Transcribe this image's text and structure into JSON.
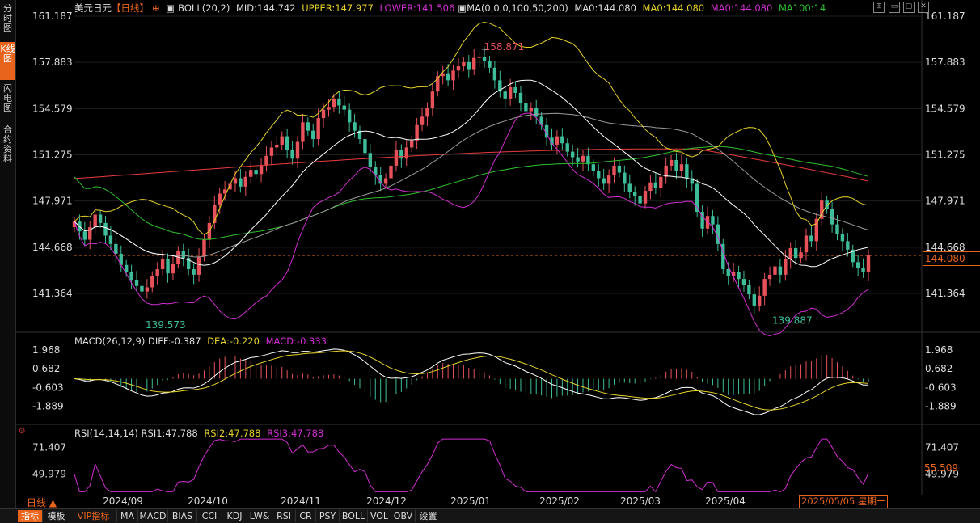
{
  "sidebar": {
    "tabs": [
      {
        "label": "分时图",
        "active": false
      },
      {
        "label": "K线图",
        "active": true
      },
      {
        "label": "闪电图",
        "active": false
      },
      {
        "label": "合约资料",
        "active": false
      }
    ]
  },
  "header": {
    "symbol": "美元日元",
    "period_tag": "【日线】",
    "boll_label": "BOLL(20,2)",
    "boll_mid": "MID:144.742",
    "boll_upper": "UPPER:147.977",
    "boll_lower": "LOWER:141.506",
    "ma_label": "MA(0,0,0,100,50,200)",
    "ma0_a": "MA0:144.080",
    "ma0_b": "MA0:144.080",
    "ma0_c": "MA0:144.080",
    "ma100": "MA100:14"
  },
  "price_axis": {
    "ticks": [
      "161.187",
      "157.883",
      "154.579",
      "151.275",
      "147.971",
      "144.668",
      "141.364"
    ],
    "current_price": "144.080"
  },
  "annotations": {
    "high": "158.871",
    "low1": "139.573",
    "low2": "139.887"
  },
  "macd": {
    "label": "MACD(26,12,9)",
    "diff": "DIFF:-0.387",
    "dea": "DEA:-0.220",
    "macd": "MACD:-0.333",
    "ticks": [
      "1.968",
      "0.682",
      "-0.603",
      "-1.889"
    ]
  },
  "rsi": {
    "label": "RSI(14,14,14)",
    "rsi1": "RSI1:47.788",
    "rsi2": "RSI2:47.788",
    "rsi3": "RSI3:47.788",
    "ticks": [
      "71.407",
      "49.979"
    ],
    "current": "55.509"
  },
  "time_axis": {
    "labels": [
      "2024/09",
      "2024/10",
      "2024/11",
      "2024/12",
      "2025/01",
      "2025/02",
      "2025/03",
      "2025/04"
    ],
    "cursor_date": "2025/05/05 星期一"
  },
  "period_label": "日线 ▲",
  "bottom_tabs": [
    "指标",
    "模板",
    "VIP指标",
    "MA",
    "MACD",
    "BIAS",
    "CCI",
    "KDJ",
    "LW&",
    "RSI",
    "CR",
    "PSY",
    "BOLL",
    "VOL",
    "OBV",
    "设置"
  ],
  "colors": {
    "up": "#e8525a",
    "down": "#3dbd9a",
    "boll_mid": "#ffffff",
    "boll_upper": "#e6d22a",
    "boll_lower": "#d12fd1",
    "ma50": "#9a9a9a",
    "ma100": "#2ec12e",
    "ma200": "#e83c3c",
    "accent": "#e8641c"
  },
  "chart_data": [
    {
      "type": "candlestick",
      "title": "美元日元 日线",
      "y_range": [
        139.573,
        161.187
      ],
      "x_range": [
        "2024/08",
        "2025/05/05"
      ],
      "annotated_high": 158.871,
      "annotated_lows": [
        139.573,
        139.887
      ],
      "last_close": 144.08,
      "series": [
        {
          "name": "MID",
          "value": 144.742
        },
        {
          "name": "UPPER",
          "value": 147.977
        },
        {
          "name": "LOWER",
          "value": 141.506
        },
        {
          "name": "MA0",
          "value": 144.08
        }
      ],
      "closes": [
        146.5,
        145.8,
        145.2,
        146.1,
        147.0,
        146.4,
        145.5,
        144.9,
        144.2,
        143.4,
        142.9,
        142.3,
        141.9,
        141.5,
        141.8,
        142.6,
        143.1,
        143.8,
        142.8,
        143.5,
        144.4,
        143.9,
        143.1,
        142.7,
        144.0,
        145.2,
        146.4,
        147.7,
        148.5,
        148.8,
        149.2,
        149.6,
        149.0,
        149.7,
        150.2,
        149.9,
        150.5,
        151.2,
        151.8,
        152.0,
        152.6,
        151.6,
        151.0,
        152.2,
        153.6,
        153.0,
        152.4,
        153.9,
        154.5,
        154.7,
        155.3,
        154.8,
        154.5,
        153.6,
        153.0,
        152.4,
        151.4,
        150.4,
        149.8,
        149.2,
        149.6,
        150.5,
        151.6,
        151.0,
        151.8,
        152.3,
        153.4,
        154.0,
        154.6,
        155.8,
        156.9,
        157.1,
        156.6,
        157.3,
        157.6,
        157.9,
        157.4,
        158.2,
        158.3,
        158.0,
        157.5,
        156.6,
        155.8,
        155.3,
        156.1,
        155.7,
        155.0,
        154.4,
        154.6,
        154.0,
        153.4,
        152.5,
        152.0,
        152.6,
        152.1,
        151.5,
        151.1,
        150.8,
        151.2,
        150.6,
        150.1,
        149.6,
        149.2,
        149.8,
        150.5,
        150.0,
        149.2,
        148.6,
        148.3,
        147.8,
        148.7,
        149.3,
        148.9,
        149.7,
        150.5,
        150.9,
        150.1,
        150.6,
        149.6,
        149.2,
        147.2,
        146.0,
        146.9,
        146.3,
        144.9,
        143.1,
        142.6,
        142.9,
        142.4,
        142.0,
        141.3,
        140.5,
        141.2,
        142.4,
        142.7,
        143.3,
        142.7,
        143.8,
        144.6,
        143.9,
        144.3,
        145.5,
        145.1,
        146.7,
        148.0,
        147.4,
        146.3,
        145.6,
        145.1,
        144.5,
        143.6,
        143.2,
        142.9,
        144.08
      ],
      "macd_diff": -0.387,
      "macd_dea": -0.22,
      "macd_hist": -0.333,
      "rsi1": 47.788,
      "rsi2": 47.788,
      "rsi3": 47.788
    }
  ]
}
